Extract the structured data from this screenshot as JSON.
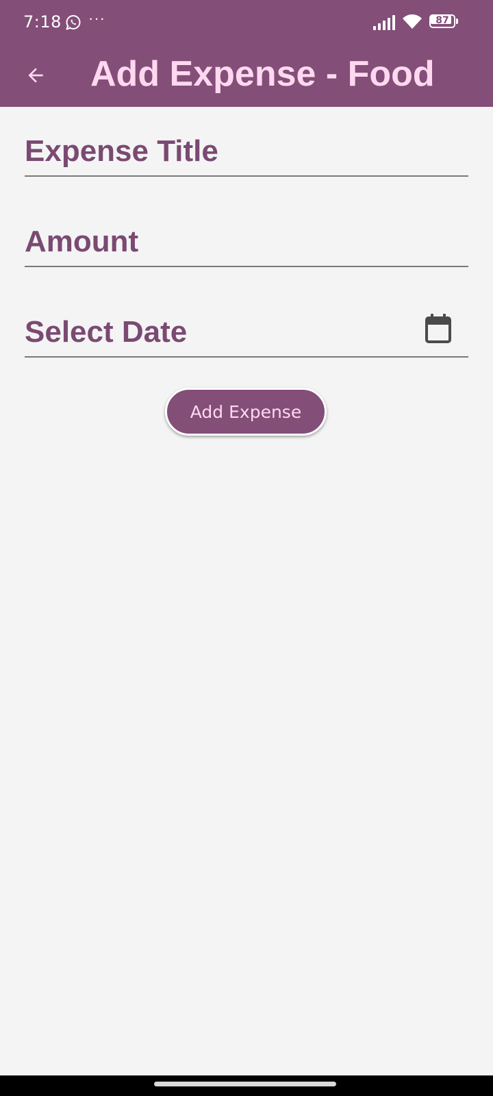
{
  "status_bar": {
    "time": "7:18",
    "notification_icon": "whatsapp-icon",
    "more_indicator": "···",
    "signal_icon": "cell-signal-icon",
    "wifi_icon": "wifi-icon",
    "battery_level": "87"
  },
  "app_bar": {
    "back_icon": "arrow-back-icon",
    "title": "Add Expense - Food"
  },
  "form": {
    "title_field": {
      "placeholder": "Expense Title",
      "value": ""
    },
    "amount_field": {
      "placeholder": "Amount",
      "value": ""
    },
    "date_field": {
      "placeholder": "Select Date",
      "value": "",
      "icon": "calendar-icon"
    },
    "submit_label": "Add Expense"
  },
  "colors": {
    "primary": "#834e78",
    "on_primary": "#ffd8f0",
    "label": "#7a4a72",
    "background": "#f4f4f4",
    "divider": "#7d767b"
  }
}
